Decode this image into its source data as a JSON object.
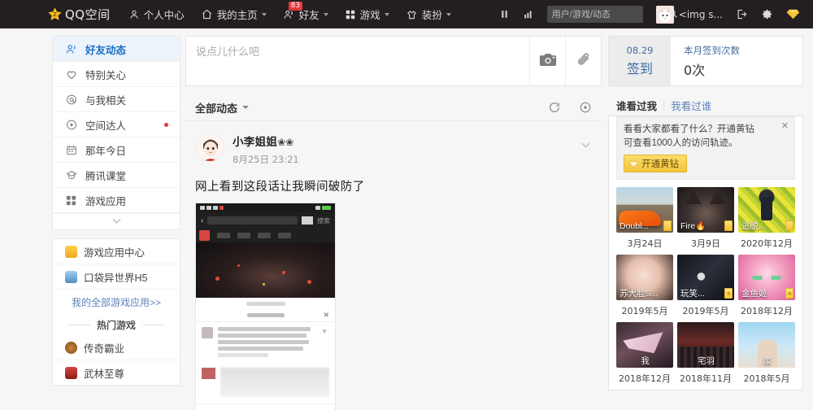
{
  "topbar": {
    "logo_text": "QQ空间",
    "nav_items": [
      {
        "label": "个人中心",
        "icon": "person-icon",
        "caret": false,
        "badge": null
      },
      {
        "label": "我的主页",
        "icon": "home-icon",
        "caret": true,
        "badge": null
      },
      {
        "label": "好友",
        "icon": "friends-icon",
        "caret": true,
        "badge": "83"
      },
      {
        "label": "游戏",
        "icon": "grid-icon",
        "caret": true,
        "badge": null
      },
      {
        "label": "装扮",
        "icon": "shirt-icon",
        "caret": true,
        "badge": null
      }
    ],
    "pause_icon": "pause-icon",
    "chart_icon": "bar-chart-icon",
    "search_placeholder": "用户/游戏/动态",
    "search_value": "",
    "search_icon": "search-icon",
    "username": "<img s...",
    "logout_icon": "logout-icon",
    "settings_icon": "gear-icon",
    "diamond_icon": "yellow-diamond-icon"
  },
  "sidebar": {
    "items": [
      {
        "label": "好友动态",
        "icon": "friends-feed-icon",
        "active": true,
        "dot": false
      },
      {
        "label": "特别关心",
        "icon": "heart-icon",
        "active": false,
        "dot": false
      },
      {
        "label": "与我相关",
        "icon": "at-icon",
        "active": false,
        "dot": false
      },
      {
        "label": "空间达人",
        "icon": "play-circle-icon",
        "active": false,
        "dot": true
      },
      {
        "label": "那年今日",
        "icon": "calendar-icon",
        "active": false,
        "dot": false
      },
      {
        "label": "腾讯课堂",
        "icon": "class-icon",
        "active": false,
        "dot": false
      },
      {
        "label": "游戏应用",
        "icon": "grid-icon",
        "active": false,
        "dot": false
      }
    ],
    "expand_icon": "chevron-down-icon",
    "games": [
      {
        "label": "游戏应用中心",
        "color": "#f0b429"
      },
      {
        "label": "口袋异世界H5",
        "color": "#5aa8d6"
      }
    ],
    "all_games_link": "我的全部游戏应用>>",
    "hot_title": "热门游戏",
    "hot_games": [
      {
        "label": "传奇霸业",
        "color": "#8c5a28"
      },
      {
        "label": "武林至尊",
        "color": "#b03326"
      }
    ]
  },
  "composer": {
    "placeholder": "说点儿什么吧",
    "value": "",
    "camera_icon": "camera-icon",
    "attach_icon": "paperclip-icon"
  },
  "feedbar": {
    "filter_label": "全部动态",
    "refresh_icon": "refresh-icon",
    "target_icon": "target-icon"
  },
  "post": {
    "author": "小李姐姐",
    "author_emoji": "❀❀",
    "time": "8月25日 23:21",
    "text": "网上看到这段话让我瞬间破防了",
    "more_icon": "chevron-down-icon",
    "image_alt": "phone-screenshot-image"
  },
  "signin": {
    "date": "08.29",
    "action": "签到",
    "count_label": "本月签到次数",
    "count_value": "0次"
  },
  "visitors": {
    "tab_active": "谁看过我",
    "tab_other": "我看过谁",
    "promo": {
      "line1": "看看大家都看了什么？开通黄钻",
      "line2": "可查看1000人的访问轨迹。",
      "button": "开通黄钻",
      "close_icon": "close-icon",
      "diamond_icon": "yellow-diamond-icon"
    },
    "cells": [
      {
        "name": "Doubl...",
        "date": "3月24日",
        "art": "art-car",
        "badge": "diamond"
      },
      {
        "name": "Fire🔥",
        "date": "3月9日",
        "art": "art-cat",
        "badge": "diamond"
      },
      {
        "name": "逃脱...",
        "date": "2020年12月",
        "art": "art-flower",
        "badge": "diamond"
      },
      {
        "name": "苏大脸S...",
        "date": "2019年5月",
        "art": "art-girl",
        "badge": "none"
      },
      {
        "name": "玩笑...",
        "date": "2019年5月",
        "art": "art-dark",
        "badge": "star"
      },
      {
        "name": "金鱼姬",
        "date": "2018年12月",
        "art": "art-anime",
        "badge": "star"
      },
      {
        "name": "我",
        "date": "2018年12月",
        "art": "art-paper",
        "badge": "none"
      },
      {
        "name": "宅羽",
        "date": "2018年11月",
        "art": "art-stage",
        "badge": "none"
      },
      {
        "name": "渁",
        "date": "2018年5月",
        "art": "art-sky",
        "badge": "none"
      }
    ]
  },
  "colors": {
    "topbar_bg": "#231f20",
    "page_bg": "#f6f6f6",
    "accent_blue": "#5b82b8",
    "active_blue": "#1a6fc4",
    "badge_red": "#e4393c",
    "diamond_yellow": "#f2c53c"
  }
}
